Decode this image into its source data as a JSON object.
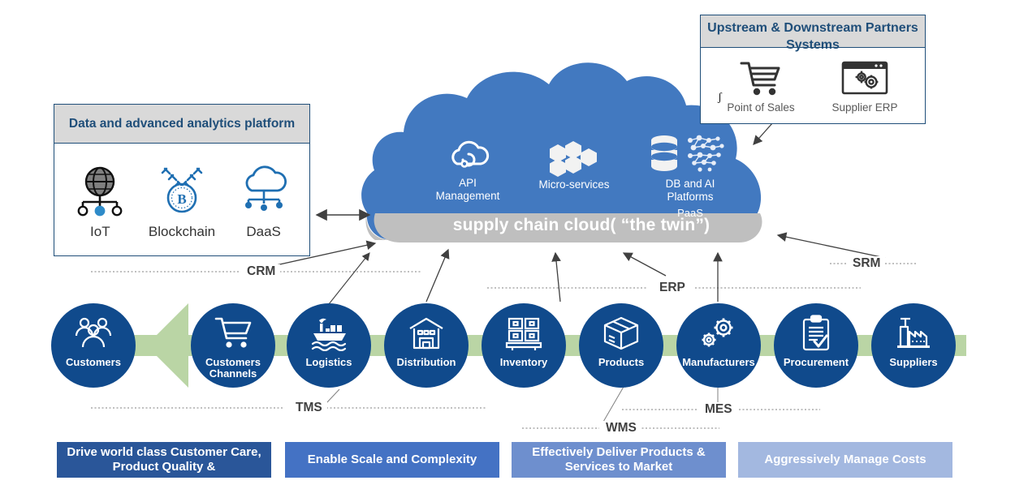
{
  "colors": {
    "circle_blue": "#104A8C",
    "cloud_blue": "#4279C0",
    "cloud_base_gray": "#BFBFBF",
    "green_band": "#BAD5A5",
    "panel_border": "#1F4E79",
    "panel_head_bg": "#D9D9D9",
    "panel_head_text": "#1F4E79",
    "connector_text": "#404040"
  },
  "analytics_panel": {
    "title": "Data and advanced analytics platform",
    "tiles": [
      {
        "label": "IoT",
        "icon": "iot-globe-icon"
      },
      {
        "label": "Blockchain",
        "icon": "blockchain-coin-icon"
      },
      {
        "label": "DaaS",
        "icon": "cloud-data-icon"
      }
    ]
  },
  "partners_panel": {
    "title": "Upstream & Downstream Partners Systems",
    "stray_glyph": "ʃ",
    "tiles": [
      {
        "label": "Point of Sales",
        "icon": "shopping-cart-icon"
      },
      {
        "label": "Supplier ERP",
        "icon": "browser-gears-icon"
      }
    ]
  },
  "cloud": {
    "title": "supply chain cloud( “the twin”)",
    "paas_label": "PaaS",
    "items": [
      {
        "label": "API\nManagement",
        "label_lines": [
          "API",
          "Management"
        ],
        "icon": "api-cloud-icon"
      },
      {
        "label": "Micro-services",
        "label_lines": [
          "Micro-services"
        ],
        "icon": "hexagon-microservices-icon"
      },
      {
        "label": "DB and AI Platforms",
        "label_lines": [
          "DB  and AI",
          "Platforms"
        ],
        "icon": "database-ai-icon"
      }
    ]
  },
  "chain_nodes": [
    {
      "label_lines": [
        "Customers"
      ],
      "icon": "people-group-icon"
    },
    {
      "label_lines": [
        "Customers",
        "Channels"
      ],
      "icon": "shopping-cart-icon"
    },
    {
      "label_lines": [
        "Logistics"
      ],
      "icon": "cargo-ship-icon"
    },
    {
      "label_lines": [
        "Distribution"
      ],
      "icon": "warehouse-icon"
    },
    {
      "label_lines": [
        "Inventory"
      ],
      "icon": "pallet-boxes-icon"
    },
    {
      "label_lines": [
        "Products"
      ],
      "icon": "carton-box-icon"
    },
    {
      "label_lines": [
        "Manufacturers"
      ],
      "icon": "gears-icon"
    },
    {
      "label_lines": [
        "Procurement"
      ],
      "icon": "clipboard-check-icon"
    },
    {
      "label_lines": [
        "Suppliers"
      ],
      "icon": "factory-icon"
    }
  ],
  "connectors": [
    {
      "id": "crm",
      "label": "CRM"
    },
    {
      "id": "erp",
      "label": "ERP"
    },
    {
      "id": "srm",
      "label": "SRM"
    },
    {
      "id": "tms",
      "label": "TMS"
    },
    {
      "id": "wms",
      "label": "WMS"
    },
    {
      "id": "mes",
      "label": "MES"
    }
  ],
  "banners": [
    {
      "text": "Drive world class Customer Care, Product Quality &",
      "color": "#2A5699"
    },
    {
      "text": "Enable Scale and Complexity",
      "color": "#4472C4"
    },
    {
      "text": "Effectively Deliver Products & Services to Market",
      "color": "#6E8FCE"
    },
    {
      "text": "Aggressively Manage Costs",
      "color": "#A3B8E0"
    }
  ]
}
